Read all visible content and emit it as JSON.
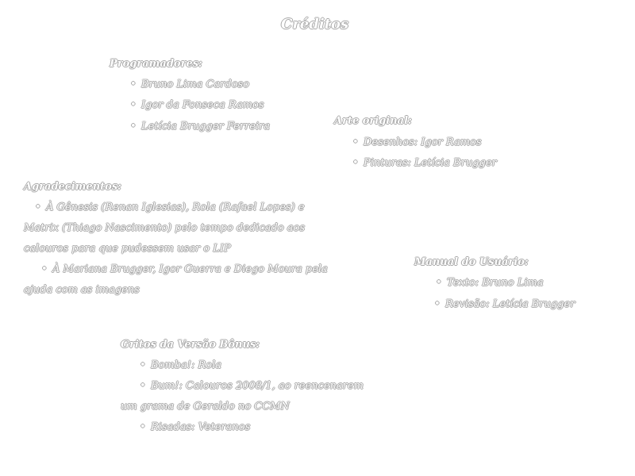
{
  "title": "Créditos",
  "programadores": {
    "heading": "Programadores:",
    "items": [
      "Bruno Lima Cardoso",
      "Igor da Fonseca Ramos",
      "Letícia Brugger Ferreira"
    ]
  },
  "arte": {
    "heading": "Arte original:",
    "items": [
      "Desenhos: Igor Ramos",
      "Pinturas: Letícia Brugger"
    ]
  },
  "agradecimentos": {
    "heading": "Agradecimentos:",
    "item1_line1": "À Gênesis (Renan Iglesias), Rola (Rafael Lopes) e",
    "item1_line2": "Matrix (Thiago Nascimento) pelo tempo dedicado aos",
    "item1_line3": "calouros para que pudessem usar o LIP",
    "item2_line1": "À Mariana Brugger, Igor Guerra e Diego Moura pela",
    "item2_line2": "ajuda com as imagens"
  },
  "manual": {
    "heading": "Manual do Usuário:",
    "items": [
      "Texto: Bruno Lima",
      "Revisão: Letícia Brugger"
    ]
  },
  "gritos": {
    "heading": "Gritos da Versão Bônus:",
    "item1": "Bomba!: Rola",
    "item2_line1": "Bum!: Calouros 2008/1, ao reencenarem",
    "item2_line2": "um grama de Geraldo no CCMN",
    "item3": "Risadas: Veteranos"
  }
}
